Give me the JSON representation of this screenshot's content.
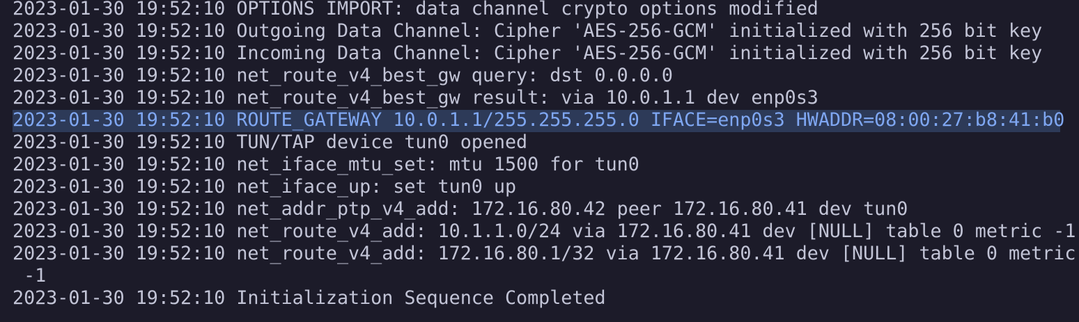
{
  "terminal": {
    "lines": [
      "2023-01-30 19:52:10 OPTIONS IMPORT: data channel crypto options modified",
      "2023-01-30 19:52:10 Outgoing Data Channel: Cipher 'AES-256-GCM' initialized with 256 bit key",
      "2023-01-30 19:52:10 Incoming Data Channel: Cipher 'AES-256-GCM' initialized with 256 bit key",
      "2023-01-30 19:52:10 net_route_v4_best_gw query: dst 0.0.0.0",
      "2023-01-30 19:52:10 net_route_v4_best_gw result: via 10.0.1.1 dev enp0s3",
      "2023-01-30 19:52:10 ROUTE_GATEWAY 10.0.1.1/255.255.255.0 IFACE=enp0s3 HWADDR=08:00:27:b8:41:b0",
      "2023-01-30 19:52:10 TUN/TAP device tun0 opened",
      "2023-01-30 19:52:10 net_iface_mtu_set: mtu 1500 for tun0",
      "2023-01-30 19:52:10 net_iface_up: set tun0 up",
      "2023-01-30 19:52:10 net_addr_ptp_v4_add: 172.16.80.42 peer 172.16.80.41 dev tun0",
      "2023-01-30 19:52:10 net_route_v4_add: 10.1.1.0/24 via 172.16.80.41 dev [NULL] table 0 metric -1",
      "2023-01-30 19:52:10 net_route_v4_add: 172.16.80.1/32 via 172.16.80.41 dev [NULL] table 0 metric",
      " -1",
      "2023-01-30 19:52:10 Initialization Sequence Completed"
    ],
    "selected_line_index": 5,
    "colors": {
      "background": "#1c1b29",
      "text": "#c2c4d6",
      "selection_bg": "#2d3a58",
      "selection_text": "#7fa7f2"
    }
  }
}
